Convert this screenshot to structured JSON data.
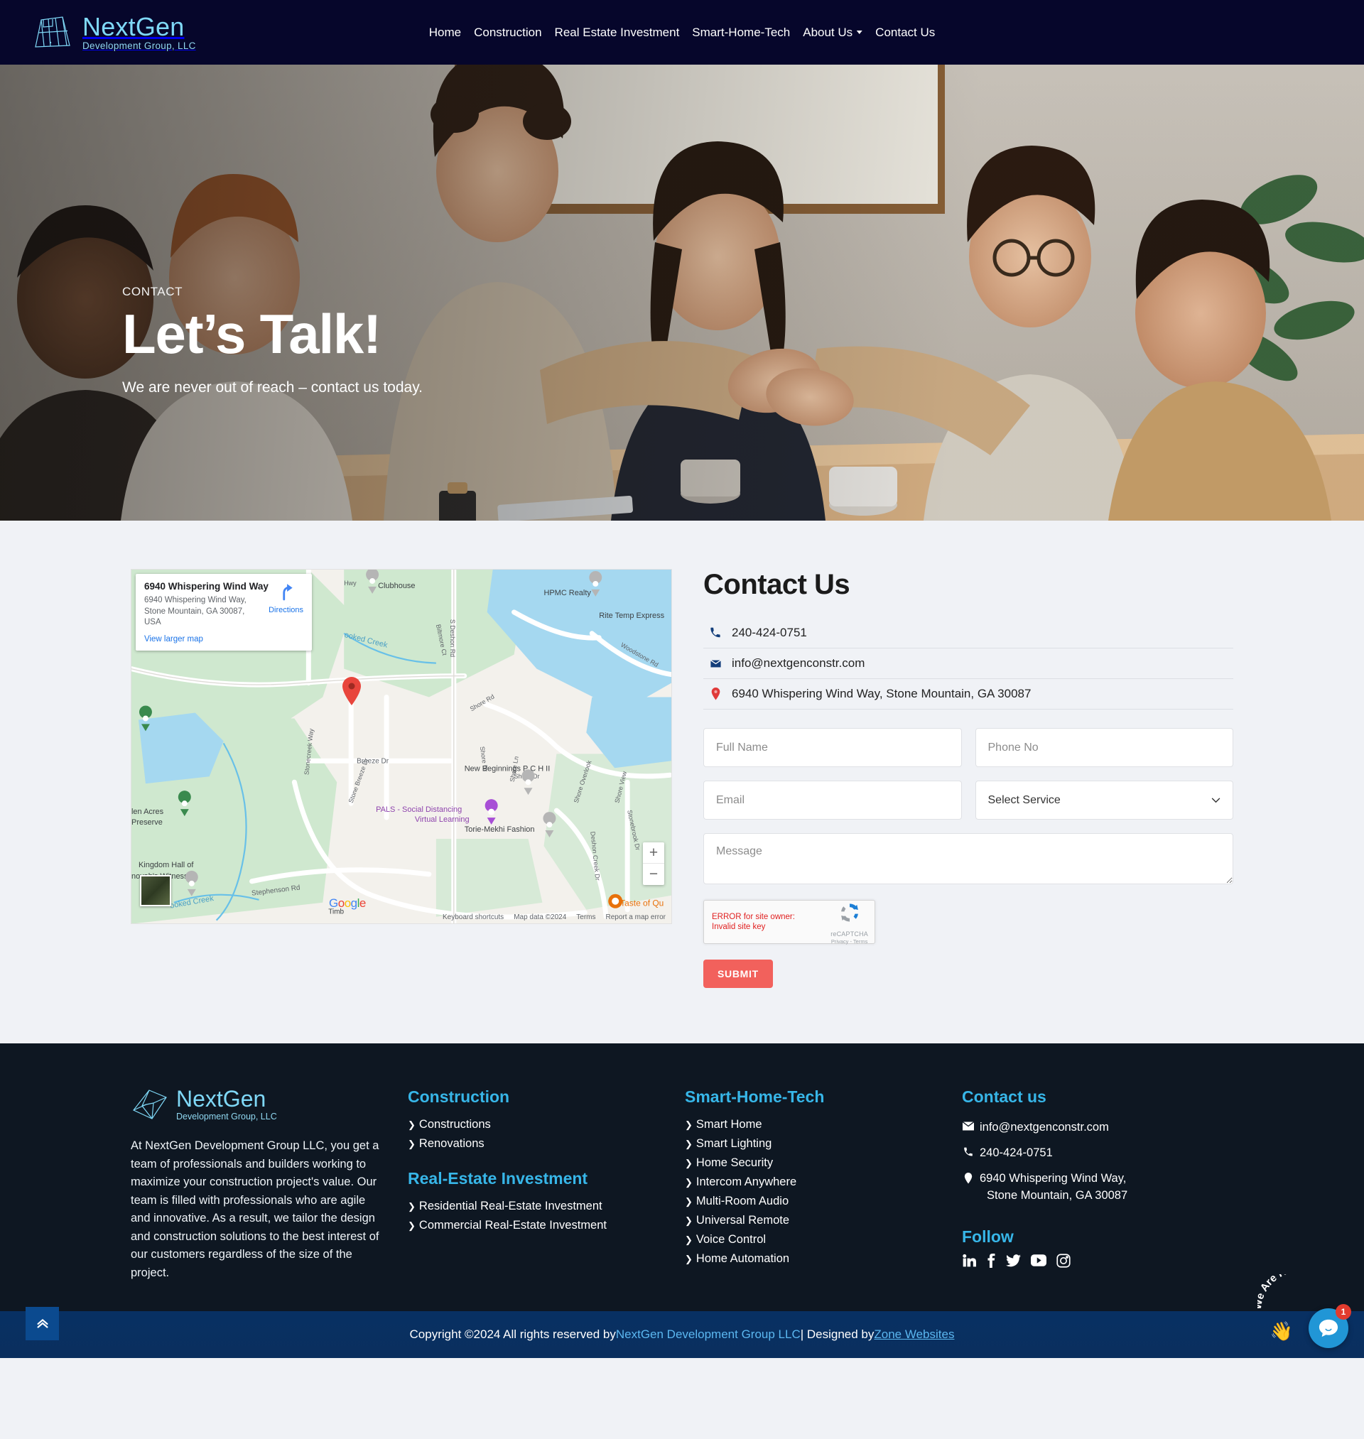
{
  "header": {
    "brand": {
      "name": "NextGen",
      "sub": "Development Group, LLC",
      "logo_icon": "nextgen-frame-logo"
    },
    "nav": [
      {
        "label": "Home",
        "has_caret": false
      },
      {
        "label": "Construction",
        "has_caret": false
      },
      {
        "label": "Real Estate Investment",
        "has_caret": false
      },
      {
        "label": "Smart-Home-Tech",
        "has_caret": false
      },
      {
        "label": "About Us",
        "has_caret": true
      },
      {
        "label": "Contact Us",
        "has_caret": false
      }
    ]
  },
  "hero": {
    "eyebrow": "CONTACT",
    "title": "Let’s Talk!",
    "subtitle": "We are never out of reach – contact us today."
  },
  "map": {
    "card": {
      "title": "6940 Whispering Wind Way",
      "address": "6940 Whispering Wind Way, Stone Mountain, GA 30087, USA",
      "view_larger": "View larger map",
      "directions_label": "Directions"
    },
    "zoom_in": "+",
    "zoom_out": "−",
    "google_logo": "Google",
    "attribution": [
      "Keyboard shortcuts",
      "Map data ©2024",
      "Terms",
      "Report a map error"
    ],
    "labels": [
      "Clubhouse",
      "HPMC Realty",
      "Rite Temp Express",
      "Woodstone Rd",
      "S Deshon Rd",
      "Shore Rd",
      "Shore Dr",
      "Shore Ln",
      "Shore Overlook",
      "Shore View",
      "Breeze Dr",
      "Stonecreek Way",
      "Stone Breeze Dr",
      "Crooked Creek",
      "New Beginnings P C H II",
      "PALS - Social Distancing Virtual Learning",
      "Torie-Mekhi Fashion",
      "Stonebrook Dr",
      "Deshon Creek Dr",
      "Stephenson Rd",
      "Glen Acres Preserve",
      "Kingdom Hall of Jehovah's Witnesses",
      "Taste of Qu",
      "Timb"
    ]
  },
  "contact": {
    "heading": "Contact Us",
    "details": [
      {
        "icon": "phone-icon",
        "value": "240-424-0751"
      },
      {
        "icon": "envelope-icon",
        "value": "info@nextgenconstr.com"
      },
      {
        "icon": "map-marker-icon",
        "value": "6940 Whispering Wind Way, Stone Mountain, GA 30087"
      }
    ],
    "form": {
      "full_name_placeholder": "Full Name",
      "full_name_value": "",
      "phone_placeholder": "Phone No",
      "phone_value": "",
      "email_placeholder": "Email",
      "email_value": "",
      "service_selected": "Select Service",
      "message_placeholder": "Message",
      "message_value": "",
      "submit_label": "SUBMIT"
    },
    "recaptcha": {
      "error": "ERROR for site owner: Invalid site key",
      "label": "reCAPTCHA",
      "legal": "Privacy - Terms"
    }
  },
  "footer": {
    "brand": {
      "name": "NextGen",
      "sub": "Development Group, LLC"
    },
    "about": "At NextGen Development Group LLC, you get a team of professionals and builders working to maximize your construction project's value. Our team is filled with professionals who are agile and innovative. As a result, we tailor the design and construction solutions to the best interest of our customers regardless of the size of the project.",
    "col_construction": {
      "heading": "Construction",
      "links": [
        "Constructions",
        "Renovations"
      ]
    },
    "col_realestate": {
      "heading": "Real-Estate Investment",
      "links": [
        "Residential Real-Estate Investment",
        "Commercial Real-Estate Investment"
      ]
    },
    "col_smarthome": {
      "heading": "Smart-Home-Tech",
      "links": [
        "Smart Home",
        "Smart Lighting",
        "Home Security",
        "Intercom Anywhere",
        "Multi-Room Audio",
        "Universal Remote",
        "Voice Control",
        "Home Automation"
      ]
    },
    "col_contact": {
      "heading": "Contact us",
      "email": "info@nextgenconstr.com",
      "phone": "240-424-0751",
      "address_line1": "6940 Whispering Wind Way,",
      "address_line2": "Stone Mountain, GA 30087",
      "follow_heading": "Follow",
      "socials": [
        "linkedin-icon",
        "facebook-icon",
        "twitter-icon",
        "youtube-icon",
        "instagram-icon"
      ]
    }
  },
  "copyright": {
    "prefix": "Copyright ©2024 All rights reserved by ",
    "company": "NextGen Development Group LLC",
    "middle": " | Designed by ",
    "designer": "Zone Websites"
  },
  "chat": {
    "caption": "We Are Here!",
    "badge": "1",
    "hand_icon": "waving-hand-icon",
    "bubble_icon": "chat-bubble-icon"
  },
  "colors": {
    "header_bg": "#06062b",
    "brand_cyan": "#7fd8f7",
    "footer_bg": "#0e1722",
    "footer_heading": "#37b6e8",
    "page_bg": "#f0f2f6",
    "submit": "#f2615c",
    "copybar": "#0a3061",
    "link_blue": "#5bb7f0"
  }
}
